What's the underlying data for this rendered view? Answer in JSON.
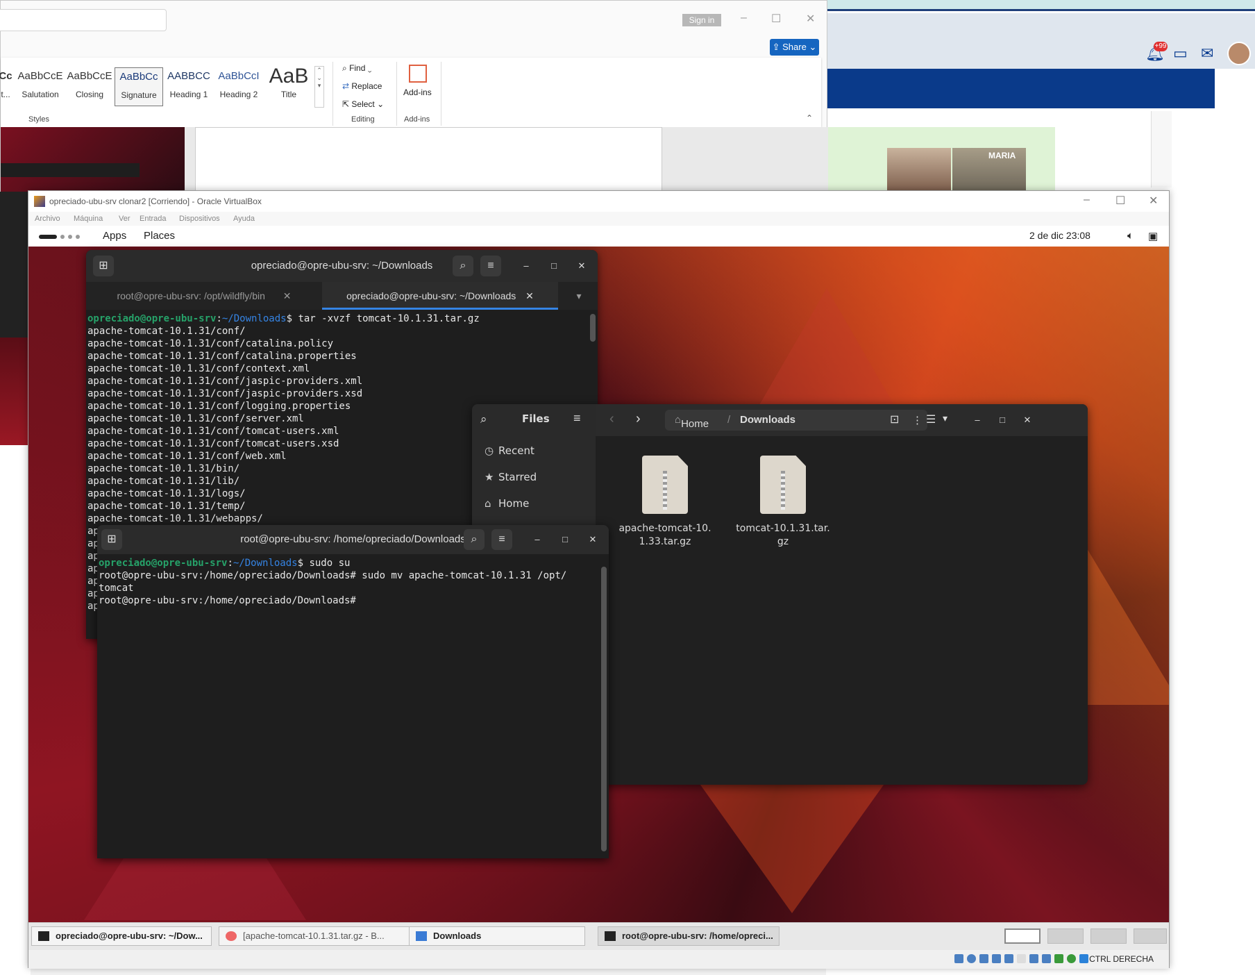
{
  "word": {
    "signin_label": "Sign in",
    "share_label": "Share",
    "styles": [
      {
        "preview": "Cc",
        "name": "t..."
      },
      {
        "preview": "AaBbCcE",
        "name": "Salutation"
      },
      {
        "preview": "AaBbCcE",
        "name": "Closing"
      },
      {
        "preview": "AaBbCc",
        "name": "Signature"
      },
      {
        "preview": "AABBCC",
        "name": "Heading 1"
      },
      {
        "preview": "AaBbCcI",
        "name": "Heading 2"
      },
      {
        "preview": "AaB",
        "name": "Title"
      }
    ],
    "groups": {
      "styles": "Styles",
      "editing": "Editing",
      "addins": "Add-ins"
    },
    "editing": {
      "find": "Find",
      "replace": "Replace",
      "select": "Select"
    },
    "addins_label": "Add-ins"
  },
  "background": {
    "notification_count": "+99",
    "photo_label": "MARIA"
  },
  "vbox": {
    "title": "opreciado-ubu-srv clonar2 [Corriendo] - Oracle VirtualBox",
    "menu": [
      "Archivo",
      "Máquina",
      "Ver",
      "Entrada",
      "Dispositivos",
      "Ayuda"
    ],
    "status_key": "CTRL DERECHA"
  },
  "gnome": {
    "apps": "Apps",
    "places": "Places",
    "clock": "2 de dic  23:08"
  },
  "term1": {
    "title": "opreciado@opre-ubu-srv: ~/Downloads",
    "tabs": [
      "root@opre-ubu-srv: /opt/wildfly/bin",
      "opreciado@opre-ubu-srv: ~/Downloads"
    ],
    "prompt_user": "opreciado@opre-ubu-srv",
    "prompt_path": "~/Downloads",
    "command": "$ tar -xvzf tomcat-10.1.31.tar.gz",
    "output": "apache-tomcat-10.1.31/conf/\napache-tomcat-10.1.31/conf/catalina.policy\napache-tomcat-10.1.31/conf/catalina.properties\napache-tomcat-10.1.31/conf/context.xml\napache-tomcat-10.1.31/conf/jaspic-providers.xml\napache-tomcat-10.1.31/conf/jaspic-providers.xsd\napache-tomcat-10.1.31/conf/logging.properties\napache-tomcat-10.1.31/conf/server.xml\napache-tomcat-10.1.31/conf/tomcat-users.xml\napache-tomcat-10.1.31/conf/tomcat-users.xsd\napache-tomcat-10.1.31/conf/web.xml\napache-tomcat-10.1.31/bin/\napache-tomcat-10.1.31/lib/\napache-tomcat-10.1.31/logs/\napache-tomcat-10.1.31/temp/\napache-tomcat-10.1.31/webapps/\nap\nap\nap\nap\nap\nap\nap"
  },
  "files": {
    "title": "Files",
    "sidebar": [
      "Recent",
      "Starred",
      "Home"
    ],
    "path_home": "Home",
    "path_current": "Downloads",
    "items": [
      "apache-tomcat-10.1.33.tar.gz",
      "tomcat-10.1.31.tar.gz"
    ]
  },
  "term2": {
    "title": "root@opre-ubu-srv: /home/opreciado/Downloads",
    "prompt_user": "opreciado@opre-ubu-srv",
    "prompt_path": "~/Downloads",
    "command": "$ sudo su",
    "output": "root@opre-ubu-srv:/home/opreciado/Downloads# sudo mv apache-tomcat-10.1.31 /opt/\ntomcat\nroot@opre-ubu-srv:/home/opreciado/Downloads#"
  },
  "taskbar": [
    "opreciado@opre-ubu-srv: ~/Dow...",
    "[apache-tomcat-10.1.31.tar.gz - B...",
    "Downloads",
    "root@opre-ubu-srv: /home/opreci..."
  ]
}
